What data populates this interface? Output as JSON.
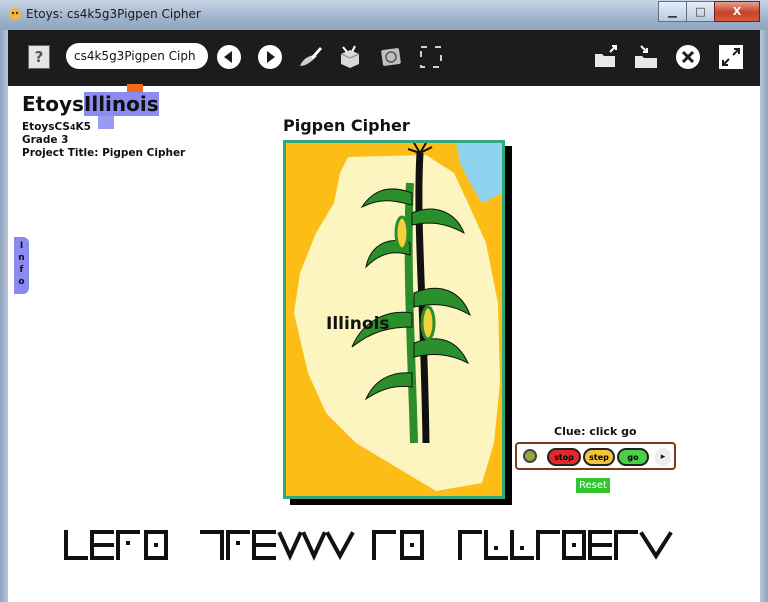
{
  "window": {
    "title": "Etoys: cs4k5g3Pigpen Cipher",
    "minimize_glyph": "▁",
    "maximize_glyph": "□",
    "close_glyph": "X"
  },
  "toolbar": {
    "help_label": "?",
    "project_name": "cs4k5g3Pigpen Ciph",
    "icons": [
      "previous-project-icon",
      "next-project-icon",
      "paint-icon",
      "supplies-icon",
      "language-icon",
      "fullscreen-icon",
      "open-project-icon",
      "save-project-icon",
      "quit-icon",
      "expand-icon"
    ]
  },
  "header": {
    "logo_prefix": "Etoys",
    "logo_highlight": "Illinois",
    "line1_prefix": "EtoysCS",
    "line1_mid": "4",
    "line1_suffix": "K5",
    "line2": "Grade 3",
    "line3": "Project Title: Pigpen Cipher"
  },
  "info_tab": {
    "letters": [
      "I",
      "n",
      "f",
      "o"
    ]
  },
  "project": {
    "title": "Pigpen Cipher",
    "map_label": "Illinois"
  },
  "script_panel": {
    "clue": "Clue: click go",
    "stop_label": "stop",
    "step_label": "step",
    "go_label": "go",
    "more_glyph": "▸",
    "reset_label": "Reset"
  },
  "colors": {
    "toolbar_bg": "#1c1c1c",
    "picture_bg": "#fbbd16",
    "picture_border": "#2fa87a",
    "illinois_shape": "#fdf5bf",
    "lake": "#8fd3ee",
    "corn_green": "#2a8f2a",
    "logo_orange": "#f06a1a",
    "logo_purple": "#8c8cf0",
    "reset_green": "#2ec82e"
  }
}
